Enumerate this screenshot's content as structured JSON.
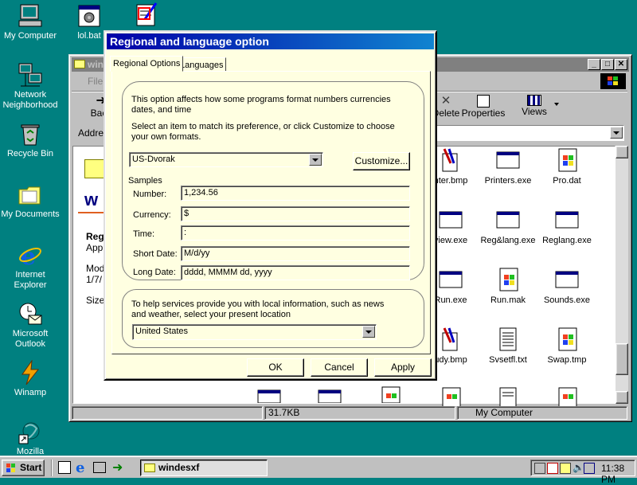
{
  "desktop": {
    "icons": [
      {
        "label": "My Computer"
      },
      {
        "label": "lol.bat"
      },
      {
        "label": "Network Neighborhood"
      },
      {
        "label": "Recycle Bin"
      },
      {
        "label": "My Documents"
      },
      {
        "label": "Internet Explorer"
      },
      {
        "label": "Microsoft Outlook"
      },
      {
        "label": "Winamp"
      },
      {
        "label": "Mozilla"
      }
    ]
  },
  "explorer": {
    "title": "windesxf",
    "menu_file": "File",
    "address_label": "Address",
    "toolbar": {
      "back": "Back",
      "delete": "Delete",
      "properties": "Properties",
      "views": "Views"
    },
    "left_pane": {
      "heading": "w",
      "line1": "Reg",
      "line2": "App",
      "line3": "Mod",
      "line4": "1/7/",
      "line5": "Size"
    },
    "col_fragment": "M",
    "files": [
      {
        "label": "nter.bmp"
      },
      {
        "label": "Printers.exe"
      },
      {
        "label": "Pro.dat"
      },
      {
        "label": "view.exe"
      },
      {
        "label": "Reg&lang.exe"
      },
      {
        "label": "Reglang.exe"
      },
      {
        "label": "Run.exe"
      },
      {
        "label": "Run.mak"
      },
      {
        "label": "Sounds.exe"
      },
      {
        "label": "udy.bmp"
      },
      {
        "label": "Svsetfl.txt"
      },
      {
        "label": "Swap.tmp"
      }
    ],
    "status_size": "31.7KB",
    "status_location": "My Computer"
  },
  "dialog": {
    "title": "Regional and language option",
    "tabs": [
      "Regional Options",
      "Languages"
    ],
    "intro_text": "This option affects how some programs format numbers currencies dates, and time",
    "select_text": "Select an item to match its preference, or click Customize to choose your own formats.",
    "locale_value": "US-Dvorak",
    "customize_label": "Customize...",
    "samples_label": "Samples",
    "samples": [
      {
        "label": "Number:",
        "value": "1,234.56"
      },
      {
        "label": "Currency:",
        "value": "$"
      },
      {
        "label": "Time:",
        "value": ":"
      },
      {
        "label": "Short Date:",
        "value": "M/d/yy"
      },
      {
        "label": "Long Date:",
        "value": "dddd, MMMM dd, yyyy"
      }
    ],
    "location_text": "To help services provide you with local information, such as news and weather, select your present location",
    "location_value": "United States",
    "ok_label": "OK",
    "cancel_label": "Cancel",
    "apply_label": "Apply"
  },
  "taskbar": {
    "start_label": "Start",
    "task_label": "windesxf",
    "clock": "11:38 PM"
  }
}
